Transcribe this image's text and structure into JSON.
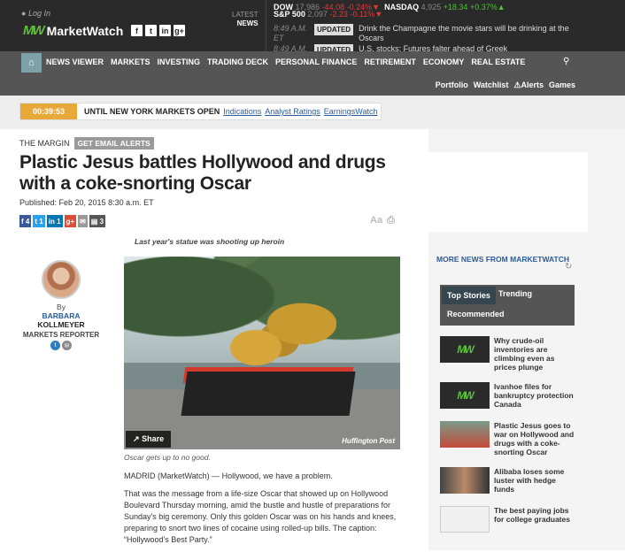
{
  "header": {
    "login": "Log In",
    "brand": "MarketWatch",
    "social": [
      "f",
      "t",
      "in",
      "g+"
    ],
    "latest_label": "LATEST",
    "news_label": "NEWS"
  },
  "tickers": [
    {
      "name": "DOW",
      "value": "17,986",
      "change": "-44.08",
      "pct": "-0.24%"
    },
    {
      "name": "NASDAQ",
      "value": "4,925",
      "change": "+18.34",
      "pct": "+0.37%"
    },
    {
      "name": "S&P 500",
      "value": "2,097",
      "change": "-2.23",
      "pct": "-0.11%"
    }
  ],
  "news_ticker": [
    {
      "time": "8:49 A.M. ET",
      "badge": "UPDATED",
      "text": "Drink the Champagne the movie stars will be drinking at the Oscars"
    },
    {
      "time": "8:49 A.M.",
      "badge": "UPDATED",
      "text": "U.S. stocks: Futures falter ahead of Greek"
    }
  ],
  "nav": {
    "items": [
      "NEWS VIEWER",
      "MARKETS",
      "INVESTING",
      "TRADING DECK",
      "PERSONAL FINANCE",
      "RETIREMENT",
      "ECONOMY",
      "REAL ESTATE"
    ],
    "sub": [
      "Portfolio",
      "Watchlist",
      "Alerts",
      "Games"
    ]
  },
  "countdown": {
    "time": "00:39:53",
    "label": "UNTIL NEW YORK MARKETS OPEN",
    "links": [
      "Indications",
      "Analyst Ratings",
      "EarningsWatch"
    ]
  },
  "article": {
    "section": "THE MARGIN",
    "email_alerts": "GET EMAIL ALERTS",
    "headline": "Plastic Jesus battles Hollywood and drugs with a coke-snorting Oscar",
    "published": "Published: Feb 20, 2015 8:30 a.m. ET",
    "share_counts": {
      "facebook": "4",
      "twitter": "1",
      "linkedin": "1",
      "email": "3"
    },
    "dek": "Last year's statue was shooting up heroin",
    "photo_share": "Share",
    "photo_credit": "Huffington Post",
    "caption": "Oscar gets up to no good.",
    "paragraphs": [
      "MADRID (MarketWatch) — Hollywood, we have a problem.",
      "That was the message from a life-size Oscar that showed up on Hollywood Boulevard Thursday morning, amid the bustle and hustle of preparations for Sunday's big ceremony. Only this golden Oscar was on his hands and knees, preparing to snort two lines of cocaine using rolled-up bills. The caption: “Hollywood's Best Party.”"
    ]
  },
  "author": {
    "by": "By",
    "first": "BARBARA",
    "last": "KOLLMEYER",
    "role": "MARKETS REPORTER"
  },
  "sidebar": {
    "title": "MORE NEWS FROM MARKETWATCH",
    "tabs": [
      "Top Stories",
      "Trending",
      "Recommended"
    ],
    "stories": [
      "Why crude-oil inventories are climbing even as prices plunge",
      "Ivanhoe files for bankruptcy protection Canada",
      "Plastic Jesus goes to war on Hollywood and drugs with a coke-snorting Oscar",
      "Alibaba loses some luster with hedge funds",
      "The best paying jobs for college graduates"
    ]
  },
  "colors": {
    "brand_green": "#5fbf3b",
    "nav_gray": "#555555",
    "countdown_orange": "#e8a83a",
    "link_blue": "#2a5b9a"
  }
}
